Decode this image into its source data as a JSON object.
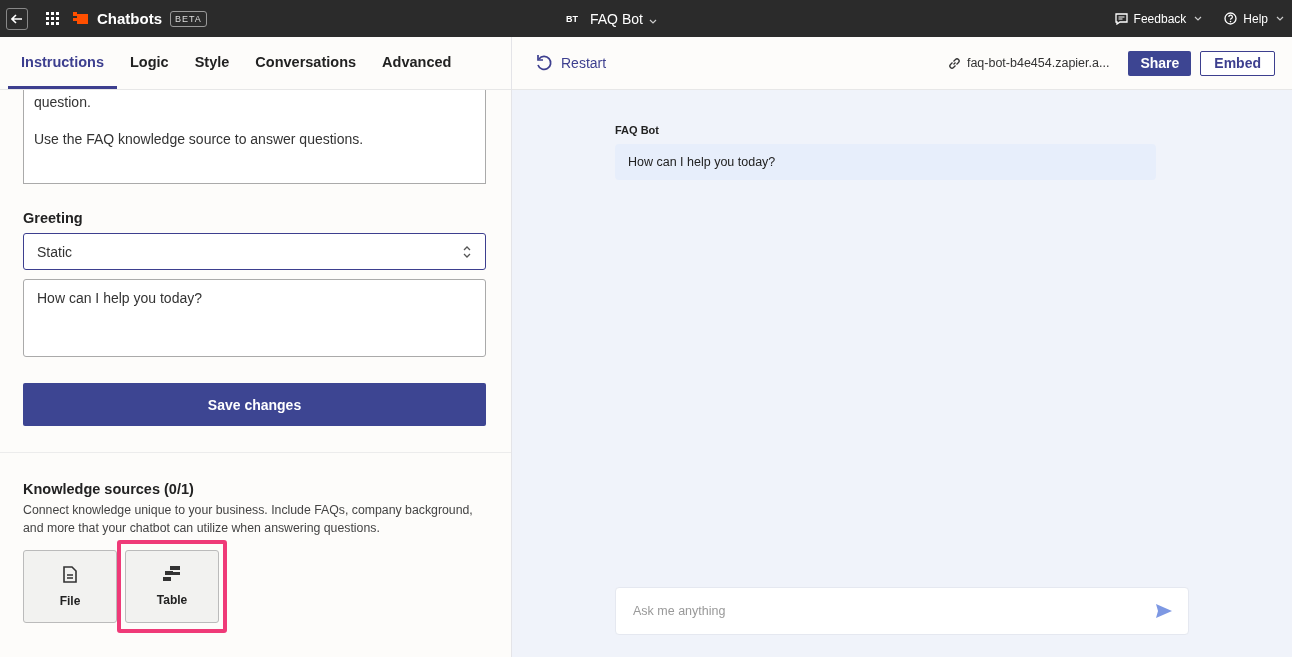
{
  "topbar": {
    "app_name": "Chatbots",
    "badge": "BETA",
    "bot_initials": "BT",
    "bot_name": "FAQ Bot",
    "menus": [
      {
        "kind": "feedback",
        "label": "Feedback"
      },
      {
        "kind": "help",
        "label": "Help"
      }
    ]
  },
  "tabs": [
    {
      "label": "Instructions",
      "selected": true
    },
    {
      "label": "Logic",
      "selected": false
    },
    {
      "label": "Style",
      "selected": false
    },
    {
      "label": "Conversations",
      "selected": false
    },
    {
      "label": "Advanced",
      "selected": false
    }
  ],
  "instructions": {
    "lines": [
      "question.",
      "Use the FAQ knowledge source to answer questions."
    ]
  },
  "greeting": {
    "label": "Greeting",
    "mode": "Static",
    "message": "How can I help you today?"
  },
  "save_button": "Save changes",
  "knowledge": {
    "title": "Knowledge sources (0/1)",
    "description": "Connect knowledge unique to your business. Include FAQs, company background, and more that your chatbot can utilize when answering questions.",
    "sources": [
      {
        "kind": "file",
        "label": "File",
        "highlighted": false
      },
      {
        "kind": "table",
        "label": "Table",
        "highlighted": true
      }
    ]
  },
  "preview": {
    "restart": "Restart",
    "link": "faq-bot-b4e454.zapier.a...",
    "share": "Share",
    "embed": "Embed",
    "sender": "FAQ Bot",
    "message": "How can I help you today?",
    "input_placeholder": "Ask me anything"
  }
}
